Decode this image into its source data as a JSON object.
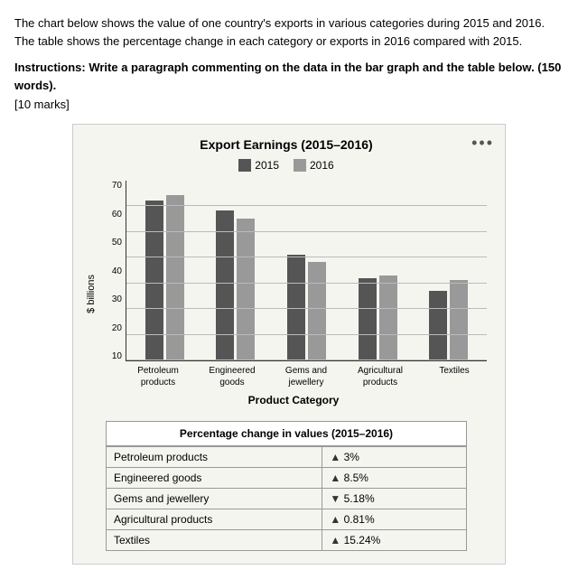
{
  "description": "The chart below shows the value of one country's exports in various categories during 2015 and 2016. The table shows the percentage change in each category or exports in 2016 compared with 2015.",
  "instructions": "Instructions: Write a paragraph commenting on the data in the bar graph and the table below. (150 words).",
  "marks": "[10 marks]",
  "chart": {
    "title": "Export Earnings (2015–2016)",
    "legend": {
      "year2015": "2015",
      "year2016": "2016"
    },
    "yAxisLabel": "$ billions",
    "xAxisTitle": "Product Category",
    "yTicks": [
      "70",
      "60",
      "50",
      "40",
      "30",
      "20",
      "10"
    ],
    "categories": [
      {
        "label": "Petroleum\nproducts",
        "val2015": 62,
        "val2016": 64
      },
      {
        "label": "Engineered\ngoods",
        "val2015": 58,
        "val2016": 55
      },
      {
        "label": "Gems and\njewellery",
        "val2015": 41,
        "val2016": 38
      },
      {
        "label": "Agricultural\nproducts",
        "val2015": 32,
        "val2016": 33
      },
      {
        "label": "Textiles",
        "val2015": 27,
        "val2016": 31
      }
    ],
    "maxValue": 70
  },
  "table": {
    "title": "Percentage change in values (2015–2016)",
    "rows": [
      {
        "category": "Petroleum products",
        "direction": "up",
        "value": "3%"
      },
      {
        "category": "Engineered goods",
        "direction": "up",
        "value": "8.5%"
      },
      {
        "category": "Gems and jewellery",
        "direction": "down",
        "value": "5.18%"
      },
      {
        "category": "Agricultural products",
        "direction": "up",
        "value": "0.81%"
      },
      {
        "category": "Textiles",
        "direction": "up",
        "value": "15.24%"
      }
    ]
  },
  "threeDots": "•••",
  "colors": {
    "bar2015": "#555555",
    "bar2016": "#999999"
  }
}
